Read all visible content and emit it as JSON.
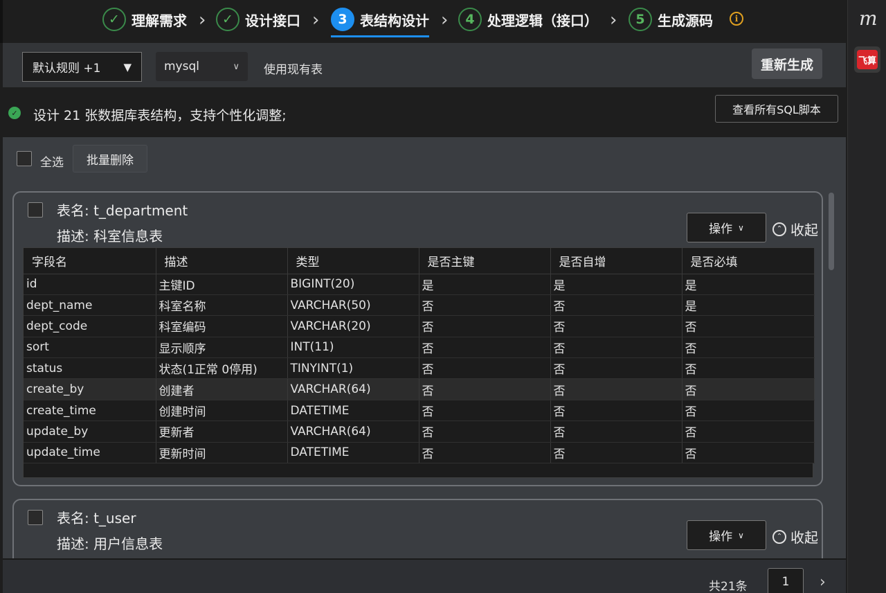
{
  "steps": [
    {
      "number": "✓",
      "label": "理解需求"
    },
    {
      "number": "✓",
      "label": "设计接口"
    },
    {
      "number": "3",
      "label": "表结构设计"
    },
    {
      "number": "4",
      "label": "处理逻辑（接口）"
    },
    {
      "number": "5",
      "label": "生成源码"
    }
  ],
  "side": {
    "logo": "m",
    "feishu_label": "飞算"
  },
  "toolbar": {
    "rule_select": "默认规则 +1",
    "db_select": "mysql",
    "use_existing": "使用现有表",
    "regen_label": "重新生成"
  },
  "banner": {
    "text": "设计 21 张数据库表结构，支持个性化调整;",
    "view_sql_label": "查看所有SQL脚本"
  },
  "bulk": {
    "select_all": "全选",
    "batch_delete": "批量删除"
  },
  "card_actions": {
    "ops_label": "操作",
    "collapse_label": "收起"
  },
  "columns": [
    "字段名",
    "描述",
    "类型",
    "是否主键",
    "是否自增",
    "是否必填"
  ],
  "tables": [
    {
      "name": "表名: t_department",
      "desc": "描述: 科室信息表",
      "rows": [
        [
          "id",
          "主键ID",
          "BIGINT(20)",
          "是",
          "是",
          "是"
        ],
        [
          "dept_name",
          "科室名称",
          "VARCHAR(50)",
          "否",
          "否",
          "是"
        ],
        [
          "dept_code",
          "科室编码",
          "VARCHAR(20)",
          "否",
          "否",
          "否"
        ],
        [
          "sort",
          "显示顺序",
          "INT(11)",
          "否",
          "否",
          "否"
        ],
        [
          "status",
          "状态(1正常 0停用)",
          "TINYINT(1)",
          "否",
          "否",
          "否"
        ],
        [
          "create_by",
          "创建者",
          "VARCHAR(64)",
          "否",
          "否",
          "否"
        ],
        [
          "create_time",
          "创建时间",
          "DATETIME",
          "否",
          "否",
          "否"
        ],
        [
          "update_by",
          "更新者",
          "VARCHAR(64)",
          "否",
          "否",
          "否"
        ],
        [
          "update_time",
          "更新时间",
          "DATETIME",
          "否",
          "否",
          "否"
        ]
      ]
    },
    {
      "name": "表名: t_user",
      "desc": "描述: 用户信息表"
    }
  ],
  "footer": {
    "total": "共21条",
    "page": "1"
  }
}
